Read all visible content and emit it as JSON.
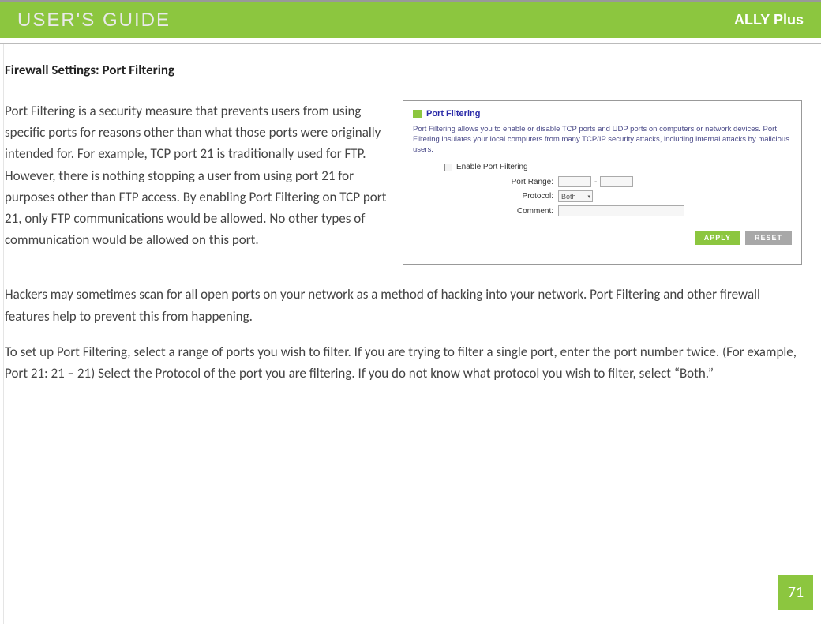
{
  "header": {
    "left": "USER'S GUIDE",
    "right": "ALLY Plus"
  },
  "section_title": "Firewall Settings: Port Filtering",
  "paragraphs": {
    "p1": "Port Filtering is a security measure that prevents users from using specific ports for reasons other than what those ports were originally intended for.  For example, TCP port 21 is traditionally used for FTP.  However, there is nothing stopping a user from using port 21 for purposes other than FTP access.  By enabling Port Filtering on TCP port 21, only FTP communications would be allowed.  No other types of communication would be allowed on this port.",
    "p2": "Hackers may sometimes scan for all open ports on your network as a method of hacking into your network.  Port Filtering and other firewall features help to prevent this from happening.",
    "p3": "To set up Port Filtering, select a range of ports you wish to filter.  If you are trying to filter a single port, enter the port number twice.  (For example, Port 21:  21 – 21) Select the Protocol of the port you are filtering.  If you do not know what protocol you wish to filter, select “Both.”"
  },
  "screenshot": {
    "title": "Port Filtering",
    "desc": "Port Filtering allows you to enable or disable TCP ports and UDP ports on computers or network devices. Port Filtering insulates your local computers from many TCP/IP security attacks, including internal attacks by malicious users.",
    "enable_label": "Enable Port Filtering",
    "labels": {
      "port_range": "Port Range:",
      "protocol": "Protocol:",
      "comment": "Comment:"
    },
    "protocol_value": "Both",
    "range_sep": "-",
    "buttons": {
      "apply": "APPLY",
      "reset": "RESET"
    }
  },
  "page_number": "71"
}
